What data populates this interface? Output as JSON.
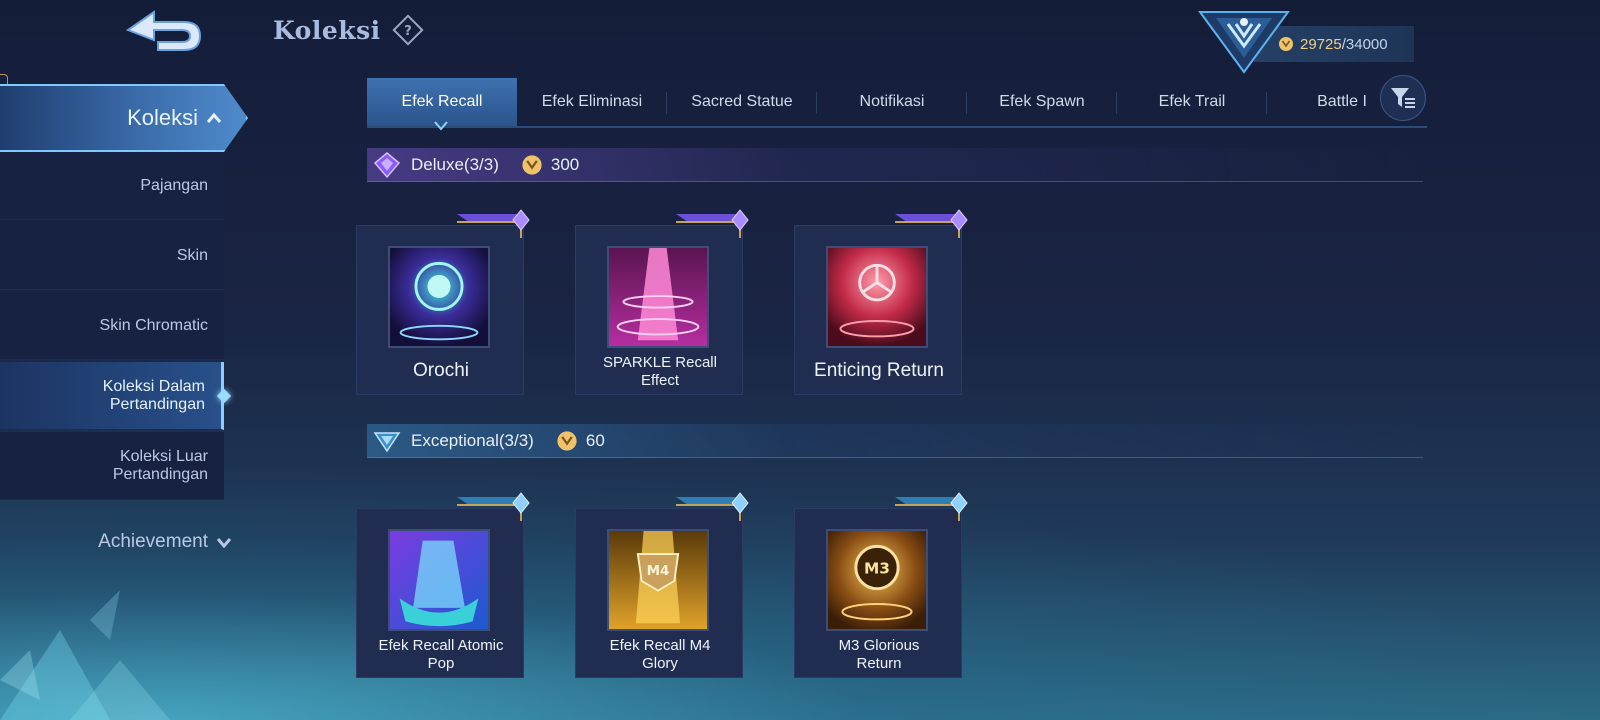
{
  "header": {
    "title": "Koleksi",
    "points_current": "29725",
    "points_max": "/34000"
  },
  "sidebar": {
    "active_label": "Koleksi",
    "items": [
      {
        "label": "Pajangan"
      },
      {
        "label": "Skin"
      },
      {
        "label": "Skin Chromatic"
      },
      {
        "label_line1": "Koleksi Dalam",
        "label_line2": "Pertandingan",
        "selected": true
      },
      {
        "label_line1": "Koleksi Luar",
        "label_line2": "Pertandingan"
      }
    ],
    "achievement_label": "Achievement"
  },
  "tabs": [
    {
      "label": "Efek Recall",
      "active": true
    },
    {
      "label": "Efek Eliminasi"
    },
    {
      "label": "Sacred Statue"
    },
    {
      "label": "Notifikasi"
    },
    {
      "label": "Efek Spawn"
    },
    {
      "label": "Efek Trail"
    },
    {
      "label": "Battle I"
    }
  ],
  "sections": [
    {
      "tier": "Deluxe",
      "count": "(3/3)",
      "price": "300",
      "accent": "#8a5cff",
      "items": [
        {
          "name": "Orochi"
        },
        {
          "name_line1": "SPARKLE Recall",
          "name_line2": "Effect"
        },
        {
          "name": "Enticing Return"
        }
      ]
    },
    {
      "tier": "Exceptional",
      "count": "(3/3)",
      "price": "60",
      "accent": "#5fb8e8",
      "items": [
        {
          "name_line1": "Efek Recall Atomic",
          "name_line2": "Pop"
        },
        {
          "name_line1": "Efek Recall M4",
          "name_line2": "Glory"
        },
        {
          "name_line1": "M3 Glorious",
          "name_line2": "Return"
        }
      ]
    }
  ],
  "icons": {
    "back": "back-arrow-icon",
    "help": "question-icon",
    "coin": "coin-icon",
    "filter": "filter-icon",
    "rank": "rank-emblem-icon"
  },
  "colors": {
    "coin": "#f0c36a",
    "active_tab": "#3f72b0",
    "highlight": "#8ad6ff"
  }
}
